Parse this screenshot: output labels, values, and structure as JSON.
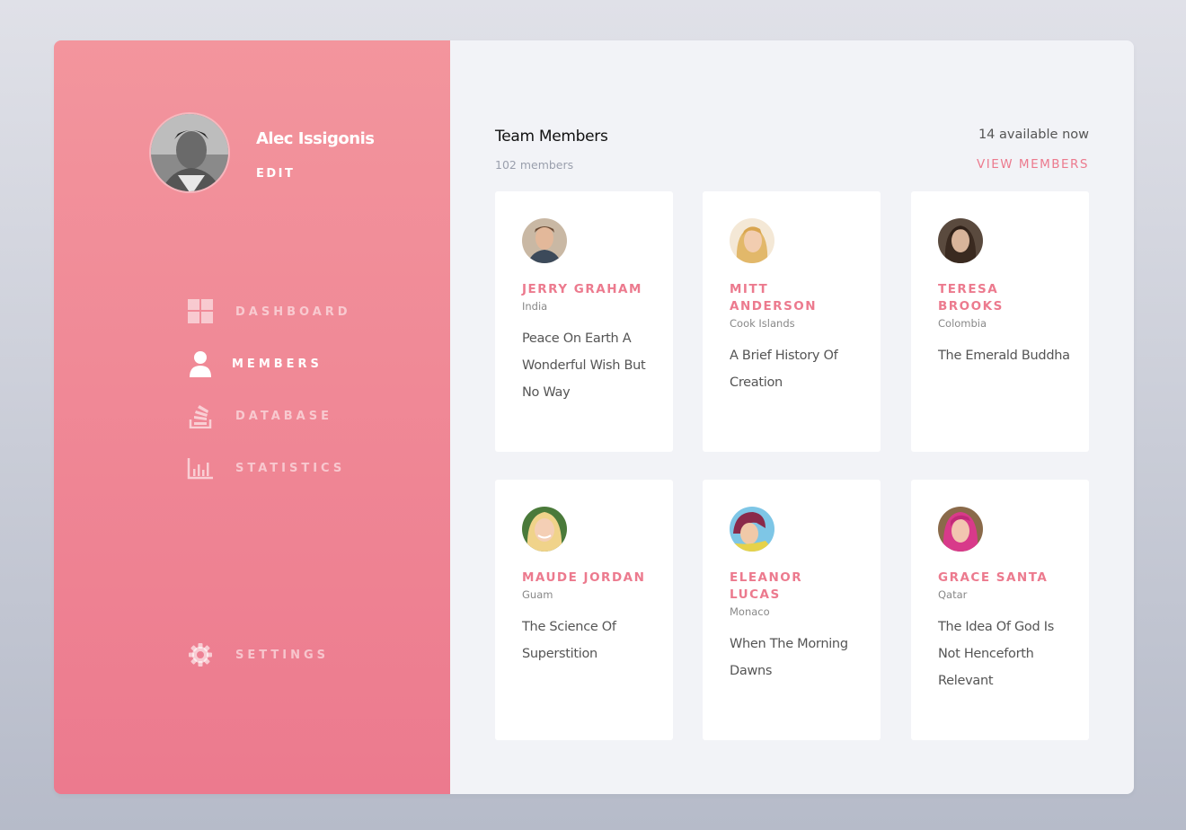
{
  "profile": {
    "name": "Alec Issigonis",
    "edit_label": "EDIT"
  },
  "nav": [
    {
      "label": "DASHBOARD",
      "icon": "dashboard-icon"
    },
    {
      "label": "MEMBERS",
      "icon": "user-icon"
    },
    {
      "label": "DATABASE",
      "icon": "database-icon"
    },
    {
      "label": "STATISTICS",
      "icon": "statistics-icon"
    },
    {
      "label": "SETTINGS",
      "icon": "gear-icon"
    }
  ],
  "team": {
    "title": "Team Members",
    "count": "102 members",
    "available": "14 available now",
    "view_label": "VIEW MEMBERS"
  },
  "members": [
    {
      "name": "JERRY GRAHAM",
      "country": "India",
      "text": "Peace On Earth A Wonderful Wish But No Way"
    },
    {
      "name": "MITT ANDERSON",
      "country": "Cook Islands",
      "text": "A Brief History Of Creation"
    },
    {
      "name": "TERESA BROOKS",
      "country": "Colombia",
      "text": "The Emerald Buddha"
    },
    {
      "name": "MAUDE JORDAN",
      "country": "Guam",
      "text": "The Science Of Superstition"
    },
    {
      "name": "ELEANOR LUCAS",
      "country": "Monaco",
      "text": "When The Morning Dawns"
    },
    {
      "name": "GRACE SANTA",
      "country": "Qatar",
      "text": "The Idea Of God Is Not Henceforth Relevant"
    }
  ],
  "colors": {
    "accent": "#ec7a8e",
    "sidebar_top": "#f3959d",
    "sidebar_bottom": "#ec7a8e"
  }
}
